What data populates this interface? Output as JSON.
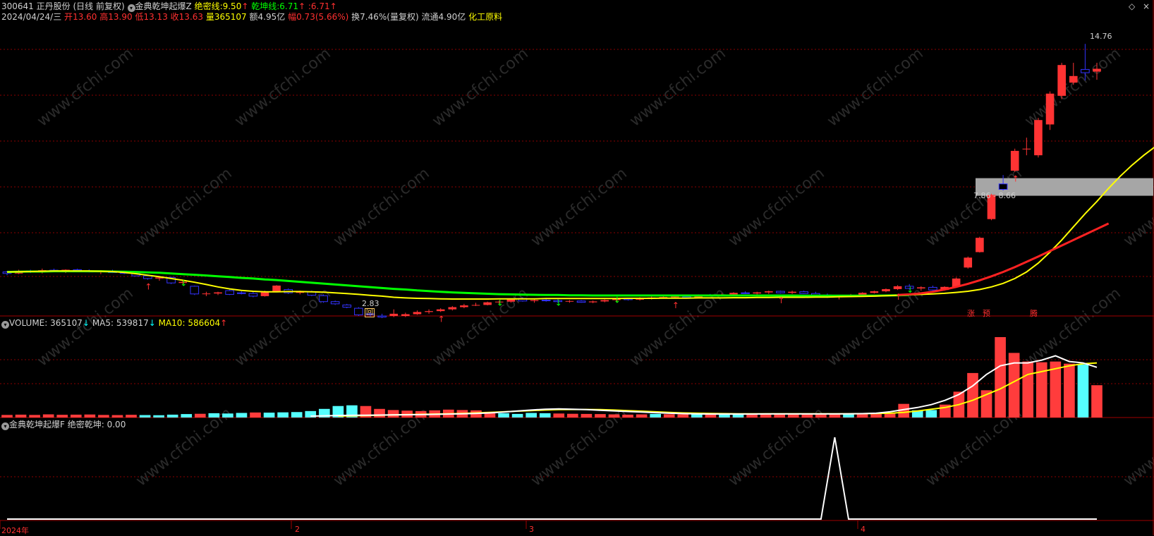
{
  "header": {
    "code": "300641",
    "name": "正丹股份",
    "period": "(日线 前复权)",
    "indicator": "金典乾坤起爆Z",
    "line1_label": "绝密线:",
    "line1_value": "9.50",
    "line2_label": "乾坤线:",
    "line2_value": "6.71",
    "line3_label": ":",
    "line3_value": "6.71",
    "date": "2024/04/24/三",
    "open_label": "开",
    "open": "13.60",
    "high_label": "高",
    "high": "13.90",
    "low_label": "低",
    "low": "13.13",
    "close_label": "收",
    "close": "13.63",
    "vol_label": "量",
    "vol": "365107",
    "amt_label": "额",
    "amt": "4.95亿",
    "chg_label": "幅",
    "chg": "0.73(5.66%)",
    "turn_label": "换",
    "turn": "7.46%(量复权)",
    "float_label": "流通",
    "float": "4.90亿",
    "sector": "化工原料"
  },
  "volume_header": {
    "label": "VOLUME:",
    "value": "365107",
    "ma5_label": "MA5:",
    "ma5": "539817",
    "ma10_label": "MA10:",
    "ma10": "586604"
  },
  "indicator_header": {
    "name": "金典乾坤起爆F",
    "label": "绝密乾坤:",
    "value": "0.00"
  },
  "annotations": {
    "high_mark": "14.76",
    "low_mark": "2.83",
    "zone_label": "7.86 - 8.66",
    "sig_hui": "回",
    "sig_zhang": "涨",
    "sig_yu": "预",
    "sig_teng": "腾"
  },
  "x_labels": [
    "2024年",
    "2",
    "3",
    "4"
  ],
  "colors": {
    "up": "#ff3333",
    "down": "#3333ff",
    "ma_yellow": "#ffff00",
    "ma_green": "#00ff00",
    "ma_red": "#ff2222",
    "vol_up": "#ff3c3c",
    "vol_down": "#55ffff",
    "grid": "#8b0000",
    "zone": "#a6a6a6"
  },
  "chart_data": {
    "type": "candlestick",
    "price_range": [
      2.4,
      15.6
    ],
    "candles": [
      [
        4.4,
        4.45,
        4.25,
        4.33
      ],
      [
        4.33,
        4.5,
        4.3,
        4.45
      ],
      [
        4.45,
        4.5,
        4.35,
        4.4
      ],
      [
        4.4,
        4.55,
        4.33,
        4.48
      ],
      [
        4.48,
        4.55,
        4.4,
        4.42
      ],
      [
        4.42,
        4.52,
        4.35,
        4.5
      ],
      [
        4.5,
        4.55,
        4.4,
        4.45
      ],
      [
        4.45,
        4.52,
        4.38,
        4.4
      ],
      [
        4.4,
        4.48,
        4.3,
        4.43
      ],
      [
        4.43,
        4.5,
        4.35,
        4.37
      ],
      [
        4.37,
        4.45,
        4.3,
        4.35
      ],
      [
        4.35,
        4.4,
        4.2,
        4.22
      ],
      [
        4.22,
        4.28,
        4.05,
        4.1
      ],
      [
        4.1,
        4.2,
        4.0,
        4.15
      ],
      [
        4.15,
        4.18,
        3.85,
        3.9
      ],
      [
        3.9,
        4.0,
        3.85,
        3.95
      ],
      [
        3.75,
        3.78,
        3.35,
        3.4
      ],
      [
        3.4,
        3.5,
        3.3,
        3.42
      ],
      [
        3.42,
        3.5,
        3.35,
        3.47
      ],
      [
        3.55,
        3.6,
        3.35,
        3.38
      ],
      [
        3.45,
        3.52,
        3.38,
        3.42
      ],
      [
        3.42,
        3.5,
        3.25,
        3.3
      ],
      [
        3.3,
        3.55,
        3.28,
        3.52
      ],
      [
        3.52,
        3.8,
        3.5,
        3.78
      ],
      [
        3.6,
        3.65,
        3.4,
        3.45
      ],
      [
        3.45,
        3.55,
        3.38,
        3.5
      ],
      [
        3.5,
        3.55,
        3.3,
        3.34
      ],
      [
        3.32,
        3.38,
        3.0,
        3.05
      ],
      [
        3.05,
        3.1,
        2.9,
        2.95
      ],
      [
        2.9,
        2.95,
        2.75,
        2.8
      ],
      [
        2.75,
        2.8,
        2.4,
        2.45
      ],
      [
        2.5,
        2.55,
        2.38,
        2.45
      ],
      [
        2.4,
        2.5,
        2.3,
        2.35
      ],
      [
        2.4,
        2.7,
        2.35,
        2.5
      ],
      [
        2.4,
        2.55,
        2.35,
        2.48
      ],
      [
        2.48,
        2.65,
        2.45,
        2.58
      ],
      [
        2.58,
        2.7,
        2.5,
        2.62
      ],
      [
        2.62,
        2.75,
        2.58,
        2.7
      ],
      [
        2.7,
        2.85,
        2.65,
        2.8
      ],
      [
        2.8,
        2.95,
        2.75,
        2.88
      ],
      [
        2.88,
        3.0,
        2.85,
        2.9
      ],
      [
        2.9,
        3.05,
        2.88,
        3.02
      ],
      [
        3.02,
        3.1,
        2.95,
        3.05
      ],
      [
        3.05,
        3.2,
        3.0,
        3.15
      ],
      [
        3.2,
        3.25,
        3.05,
        3.08
      ],
      [
        3.08,
        3.15,
        3.0,
        3.12
      ],
      [
        3.12,
        3.18,
        3.05,
        3.1
      ],
      [
        3.1,
        3.15,
        3.0,
        3.05
      ],
      [
        3.05,
        3.12,
        3.0,
        3.08
      ],
      [
        3.08,
        3.12,
        3.0,
        3.02
      ],
      [
        3.02,
        3.1,
        2.98,
        3.06
      ],
      [
        3.06,
        3.15,
        3.02,
        3.12
      ],
      [
        3.12,
        3.2,
        3.05,
        3.18
      ],
      [
        3.18,
        3.22,
        3.1,
        3.14
      ],
      [
        3.14,
        3.25,
        3.1,
        3.22
      ],
      [
        3.22,
        3.28,
        3.15,
        3.24
      ],
      [
        3.24,
        3.3,
        3.18,
        3.26
      ],
      [
        3.26,
        3.32,
        3.2,
        3.28
      ],
      [
        3.28,
        3.32,
        3.2,
        3.24
      ],
      [
        3.24,
        3.38,
        3.22,
        3.35
      ],
      [
        3.35,
        3.4,
        3.28,
        3.32
      ],
      [
        3.32,
        3.42,
        3.28,
        3.38
      ],
      [
        3.38,
        3.48,
        3.32,
        3.45
      ],
      [
        3.45,
        3.52,
        3.4,
        3.42
      ],
      [
        3.42,
        3.5,
        3.38,
        3.47
      ],
      [
        3.47,
        3.55,
        3.4,
        3.52
      ],
      [
        3.52,
        3.55,
        3.42,
        3.45
      ],
      [
        3.45,
        3.55,
        3.4,
        3.5
      ],
      [
        3.5,
        3.55,
        3.4,
        3.42
      ],
      [
        3.42,
        3.5,
        3.32,
        3.35
      ],
      [
        3.35,
        3.42,
        3.22,
        3.25
      ],
      [
        3.25,
        3.32,
        3.15,
        3.28
      ],
      [
        3.28,
        3.4,
        3.25,
        3.35
      ],
      [
        3.35,
        3.48,
        3.3,
        3.45
      ],
      [
        3.45,
        3.55,
        3.42,
        3.52
      ],
      [
        3.52,
        3.65,
        3.48,
        3.62
      ],
      [
        3.62,
        3.8,
        3.58,
        3.75
      ],
      [
        3.75,
        3.85,
        3.6,
        3.65
      ],
      [
        3.65,
        3.75,
        3.55,
        3.7
      ],
      [
        3.7,
        3.78,
        3.55,
        3.58
      ],
      [
        3.58,
        3.75,
        3.55,
        3.72
      ],
      [
        3.72,
        4.15,
        3.7,
        4.1
      ],
      [
        4.6,
        5.1,
        4.55,
        5.05
      ],
      [
        5.3,
        6.0,
        5.28,
        5.95
      ],
      [
        6.8,
        7.95,
        6.75,
        7.9
      ],
      [
        8.4,
        8.8,
        8.1,
        8.15
      ],
      [
        9.0,
        10.0,
        8.95,
        9.9
      ],
      [
        10.0,
        10.5,
        9.7,
        10.0
      ],
      [
        9.7,
        11.4,
        9.6,
        11.3
      ],
      [
        11.1,
        12.6,
        10.85,
        12.5
      ],
      [
        12.4,
        13.9,
        12.25,
        13.8
      ],
      [
        13.0,
        13.9,
        12.9,
        13.3
      ],
      [
        13.6,
        14.76,
        13.1,
        13.45
      ],
      [
        13.5,
        13.9,
        13.13,
        13.63
      ]
    ],
    "ma_yellow": [
      4.4,
      4.41,
      4.42,
      4.43,
      4.44,
      4.44,
      4.44,
      4.44,
      4.43,
      4.42,
      4.38,
      4.32,
      4.25,
      4.18,
      4.1,
      4.02,
      3.93,
      3.83,
      3.72,
      3.63,
      3.56,
      3.52,
      3.5,
      3.5,
      3.51,
      3.51,
      3.5,
      3.48,
      3.45,
      3.42,
      3.38,
      3.34,
      3.3,
      3.25,
      3.22,
      3.2,
      3.19,
      3.18,
      3.17,
      3.17,
      3.17,
      3.17,
      3.18,
      3.18,
      3.18,
      3.18,
      3.19,
      3.19,
      3.19,
      3.19,
      3.19,
      3.19,
      3.19,
      3.2,
      3.2,
      3.2,
      3.21,
      3.21,
      3.21,
      3.22,
      3.22,
      3.22,
      3.23,
      3.23,
      3.24,
      3.24,
      3.25,
      3.25,
      3.25,
      3.26,
      3.26,
      3.27,
      3.28,
      3.29,
      3.3,
      3.32,
      3.34,
      3.36,
      3.38,
      3.4,
      3.43,
      3.47,
      3.52,
      3.6,
      3.72,
      3.88,
      4.1,
      4.4,
      4.8,
      5.3,
      5.85,
      6.45,
      7.05,
      7.6,
      8.2,
      8.75,
      9.25,
      9.7,
      10.1,
      10.45
    ],
    "ma_green": [
      4.4,
      4.41,
      4.42,
      4.42,
      4.43,
      4.43,
      4.43,
      4.43,
      4.43,
      4.42,
      4.41,
      4.4,
      4.38,
      4.36,
      4.33,
      4.3,
      4.27,
      4.24,
      4.2,
      4.17,
      4.13,
      4.1,
      4.06,
      4.03,
      3.99,
      3.95,
      3.91,
      3.87,
      3.83,
      3.79,
      3.75,
      3.71,
      3.67,
      3.63,
      3.6,
      3.56,
      3.53,
      3.5,
      3.47,
      3.45,
      3.43,
      3.41,
      3.39,
      3.38,
      3.37,
      3.36,
      3.35,
      3.35,
      3.34,
      3.34,
      3.33,
      3.33,
      3.33,
      3.33,
      3.33,
      3.33,
      3.33,
      3.33,
      3.33,
      3.33,
      3.33,
      3.33,
      3.33,
      3.33,
      3.33,
      3.33,
      3.33,
      3.33,
      3.32,
      3.32,
      3.32,
      3.32,
      3.32,
      3.32,
      3.32,
      3.33,
      3.34,
      3.35
    ],
    "ma_red": [
      3.35,
      3.38,
      3.43,
      3.5,
      3.6,
      3.72,
      3.86,
      4.02,
      4.2,
      4.4,
      4.62,
      4.86,
      5.1,
      5.35,
      5.6,
      5.85,
      6.1,
      6.35,
      6.6
    ],
    "volume_range": [
      0,
      560000
    ],
    "volume": [
      [
        18000,
        1
      ],
      [
        20000,
        1
      ],
      [
        18000,
        1
      ],
      [
        22000,
        1
      ],
      [
        19000,
        1
      ],
      [
        20000,
        1
      ],
      [
        21000,
        1
      ],
      [
        18000,
        1
      ],
      [
        17000,
        1
      ],
      [
        19000,
        1
      ],
      [
        17000,
        0
      ],
      [
        16000,
        0
      ],
      [
        20000,
        0
      ],
      [
        24000,
        0
      ],
      [
        26000,
        1
      ],
      [
        30000,
        0
      ],
      [
        28000,
        0
      ],
      [
        32000,
        0
      ],
      [
        35000,
        1
      ],
      [
        34000,
        0
      ],
      [
        36000,
        0
      ],
      [
        38000,
        0
      ],
      [
        45000,
        0
      ],
      [
        60000,
        0
      ],
      [
        80000,
        0
      ],
      [
        85000,
        0
      ],
      [
        80000,
        1
      ],
      [
        60000,
        1
      ],
      [
        52000,
        1
      ],
      [
        48000,
        1
      ],
      [
        45000,
        1
      ],
      [
        50000,
        1
      ],
      [
        55000,
        1
      ],
      [
        52000,
        1
      ],
      [
        50000,
        1
      ],
      [
        40000,
        1
      ],
      [
        30000,
        0
      ],
      [
        25000,
        0
      ],
      [
        32000,
        0
      ],
      [
        30000,
        0
      ],
      [
        28000,
        1
      ],
      [
        26000,
        1
      ],
      [
        25000,
        1
      ],
      [
        24000,
        1
      ],
      [
        22000,
        1
      ],
      [
        20000,
        1
      ],
      [
        22000,
        1
      ],
      [
        25000,
        0
      ],
      [
        23000,
        1
      ],
      [
        22000,
        1
      ],
      [
        24000,
        0
      ],
      [
        25000,
        1
      ],
      [
        26000,
        0
      ],
      [
        27000,
        0
      ],
      [
        26000,
        1
      ],
      [
        24000,
        1
      ],
      [
        25000,
        1
      ],
      [
        26000,
        1
      ],
      [
        25000,
        1
      ],
      [
        26000,
        1
      ],
      [
        25000,
        1
      ],
      [
        26000,
        0
      ],
      [
        28000,
        1
      ],
      [
        30000,
        1
      ],
      [
        32000,
        1
      ],
      [
        95000,
        1
      ],
      [
        50000,
        0
      ],
      [
        52000,
        0
      ],
      [
        90000,
        1
      ],
      [
        180000,
        1
      ],
      [
        310000,
        1
      ],
      [
        190000,
        1
      ],
      [
        560000,
        1
      ],
      [
        450000,
        1
      ],
      [
        390000,
        1
      ],
      [
        385000,
        1
      ],
      [
        390000,
        1
      ],
      [
        375000,
        1
      ],
      [
        370000,
        0
      ],
      [
        225000,
        1
      ]
    ],
    "vol_ma_white": [
      10000,
      12000,
      14000,
      15000,
      16000,
      17000,
      18000,
      19000,
      20000,
      22000,
      24000,
      26000,
      28000,
      32000,
      38000,
      45000,
      52000,
      58000,
      60000,
      58000,
      55000,
      50000,
      46000,
      42000,
      38000,
      34000,
      30000,
      27000,
      25000,
      24000,
      24000,
      24000,
      24000,
      25000,
      25000,
      25000,
      25000,
      25000,
      25000,
      26000,
      27000,
      30000,
      40000,
      55000,
      70000,
      90000,
      120000,
      160000,
      220000,
      300000,
      360000,
      380000,
      380000,
      400000,
      430000,
      390000,
      380000,
      350000
    ],
    "vol_ma_yellow": [
      10000,
      12000,
      14000,
      16000,
      18000,
      20000,
      22000,
      24000,
      26000,
      28000,
      32000,
      36000,
      40000,
      44000,
      48000,
      52000,
      55000,
      56000,
      56000,
      55000,
      52000,
      48000,
      44000,
      40000,
      36000,
      32000,
      30000,
      28000,
      27000,
      26000,
      26000,
      26000,
      26000,
      26000,
      26000,
      26000,
      26000,
      26000,
      27000,
      28000,
      30000,
      36000,
      45000,
      58000,
      70000,
      90000,
      120000,
      160000,
      200000,
      250000,
      300000,
      320000,
      340000,
      360000,
      375000,
      380000
    ],
    "indicator_range": [
      0,
      1
    ],
    "indicator_spike_index": 60
  }
}
